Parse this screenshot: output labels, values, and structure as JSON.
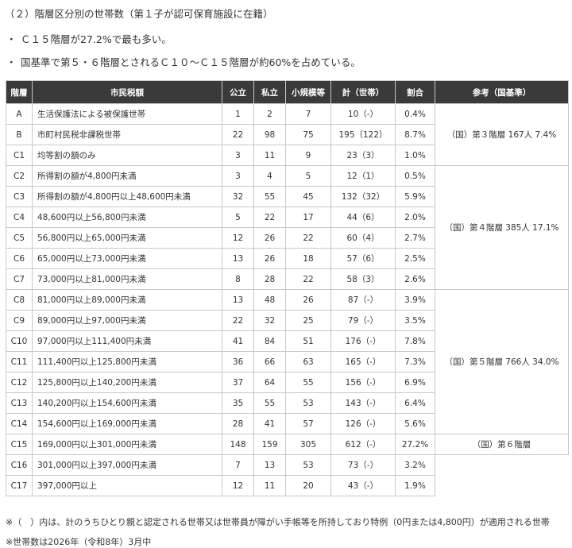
{
  "heading": "（２）階層区分別の世帯数（第１子が認可保育施設に在籍）",
  "bullets": [
    "Ｃ１５階層が27.2%で最も多い。",
    "国基準で第５・６階層とされるＣ１０〜Ｃ１５階層が約60%を占めている。"
  ],
  "bullet_mark": "・",
  "table": {
    "headers": [
      "階層",
      "市民税額",
      "公立",
      "私立",
      "小規模等",
      "計（世帯）",
      "割合",
      "参考（国基準）"
    ],
    "rows": [
      {
        "tier": "A",
        "tax": "生活保護法による被保護世帯",
        "public": "1",
        "private": "2",
        "small": "7",
        "total": "10（-）",
        "ratio": "0.4%"
      },
      {
        "tier": "B",
        "tax": "市町村民税非課税世帯",
        "public": "22",
        "private": "98",
        "small": "75",
        "total": "195（122）",
        "ratio": "8.7%"
      },
      {
        "tier": "C1",
        "tax": "均等割の額のみ",
        "public": "3",
        "private": "11",
        "small": "9",
        "total": "23（3）",
        "ratio": "1.0%"
      },
      {
        "tier": "C2",
        "tax": "所得割の額が4,800円未満",
        "public": "3",
        "private": "4",
        "small": "5",
        "total": "12（1）",
        "ratio": "0.5%"
      },
      {
        "tier": "C3",
        "tax": "所得割の額が4,800円以上48,600円未満",
        "public": "32",
        "private": "55",
        "small": "45",
        "total": "132（32）",
        "ratio": "5.9%"
      },
      {
        "tier": "C4",
        "tax": "48,600円以上56,800円未満",
        "public": "5",
        "private": "22",
        "small": "17",
        "total": "44（6）",
        "ratio": "2.0%"
      },
      {
        "tier": "C5",
        "tax": "56,800円以上65,000円未満",
        "public": "12",
        "private": "26",
        "small": "22",
        "total": "60（4）",
        "ratio": "2.7%"
      },
      {
        "tier": "C6",
        "tax": "65,000円以上73,000円未満",
        "public": "13",
        "private": "26",
        "small": "18",
        "total": "57（6）",
        "ratio": "2.5%"
      },
      {
        "tier": "C7",
        "tax": "73,000円以上81,000円未満",
        "public": "8",
        "private": "28",
        "small": "22",
        "total": "58（3）",
        "ratio": "2.6%"
      },
      {
        "tier": "C8",
        "tax": "81,000円以上89,000円未満",
        "public": "13",
        "private": "48",
        "small": "26",
        "total": "87（-）",
        "ratio": "3.9%"
      },
      {
        "tier": "C9",
        "tax": "89,000円以上97,000円未満",
        "public": "22",
        "private": "32",
        "small": "25",
        "total": "79（-）",
        "ratio": "3.5%"
      },
      {
        "tier": "C10",
        "tax": "97,000円以上111,400円未満",
        "public": "41",
        "private": "84",
        "small": "51",
        "total": "176（-）",
        "ratio": "7.8%"
      },
      {
        "tier": "C11",
        "tax": "111,400円以上125,800円未満",
        "public": "36",
        "private": "66",
        "small": "63",
        "total": "165（-）",
        "ratio": "7.3%"
      },
      {
        "tier": "C12",
        "tax": "125,800円以上140,200円未満",
        "public": "37",
        "private": "64",
        "small": "55",
        "total": "156（-）",
        "ratio": "6.9%"
      },
      {
        "tier": "C13",
        "tax": "140,200円以上154,600円未満",
        "public": "35",
        "private": "55",
        "small": "53",
        "total": "143（-）",
        "ratio": "6.4%"
      },
      {
        "tier": "C14",
        "tax": "154,600円以上169,000円未満",
        "public": "28",
        "private": "41",
        "small": "57",
        "total": "126（-）",
        "ratio": "5.6%"
      },
      {
        "tier": "C15",
        "tax": "169,000円以上301,000円未満",
        "public": "148",
        "private": "159",
        "small": "305",
        "total": "612（-）",
        "ratio": "27.2%"
      },
      {
        "tier": "C16",
        "tax": "301,000円以上397,000円未満",
        "public": "7",
        "private": "13",
        "small": "53",
        "total": "73（-）",
        "ratio": "3.2%"
      },
      {
        "tier": "C17",
        "tax": "397,000円以上",
        "public": "12",
        "private": "11",
        "small": "20",
        "total": "43（-）",
        "ratio": "1.9%"
      }
    ],
    "reference": [
      "（国）第３階層 167人 7.4%",
      "（国）第４階層 385人 17.1%",
      "（国）第５階層 766人 34.0%",
      "（国）第６階層"
    ]
  },
  "notes": [
    "※（　）内は、計のうちひとり親と認定される世帯又は世帯員が障がい手帳等を所持しており特例（0円または4,800円）が適用される世帯",
    "※世帯数は2026年（令和8年）3月中"
  ]
}
